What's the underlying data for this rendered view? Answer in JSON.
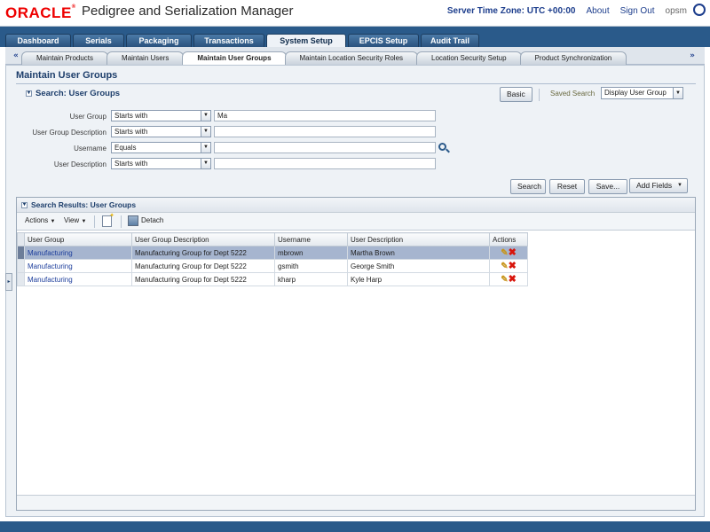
{
  "header": {
    "logo": "ORACLE",
    "app_title": "Pedigree and Serialization Manager",
    "server_time": "Server Time Zone: UTC +00:00",
    "about": "About",
    "sign_out": "Sign Out",
    "user": "opsm"
  },
  "top_tabs": [
    "Dashboard",
    "Serials",
    "Packaging",
    "Transactions",
    "System Setup",
    "EPCIS Setup",
    "Audit Trail"
  ],
  "sub_tabs": [
    "Maintain Products",
    "Maintain Users",
    "Maintain User Groups",
    "Maintain Location Security Roles",
    "Location Security Setup",
    "Product Synchronization"
  ],
  "page": {
    "title": "Maintain User Groups"
  },
  "search": {
    "title": "Search: User Groups",
    "basic_button": "Basic",
    "saved_search_label": "Saved Search",
    "saved_search_value": "Display User Group",
    "fields": [
      {
        "label": "User Group",
        "operator": "Starts with",
        "value": "Ma"
      },
      {
        "label": "User Group Description",
        "operator": "Starts with",
        "value": ""
      },
      {
        "label": "Username",
        "operator": "Equals",
        "value": ""
      },
      {
        "label": "User Description",
        "operator": "Starts with",
        "value": ""
      }
    ],
    "buttons": {
      "search": "Search",
      "reset": "Reset",
      "save": "Save...",
      "add_fields": "Add Fields"
    }
  },
  "results": {
    "title": "Search Results: User Groups",
    "toolbar": {
      "actions": "Actions",
      "view": "View",
      "detach": "Detach"
    },
    "columns": [
      "User Group",
      "User Group Description",
      "Username",
      "User Description",
      "Actions"
    ],
    "rows": [
      {
        "group": "Manufacturing",
        "description": "Manufacturing Group for Dept 5222",
        "username": "mbrown",
        "user_desc": "Martha Brown"
      },
      {
        "group": "Manufacturing",
        "description": "Manufacturing Group for Dept 5222",
        "username": "gsmith",
        "user_desc": "George Smith"
      },
      {
        "group": "Manufacturing",
        "description": "Manufacturing Group for Dept 5222",
        "username": "kharp",
        "user_desc": "Kyle Harp"
      }
    ]
  },
  "colors": {
    "brand_red": "#e00000",
    "nav_blue": "#2a5a8a",
    "selected_row": "#a6b5cf",
    "link_blue": "#1d3e9c"
  }
}
